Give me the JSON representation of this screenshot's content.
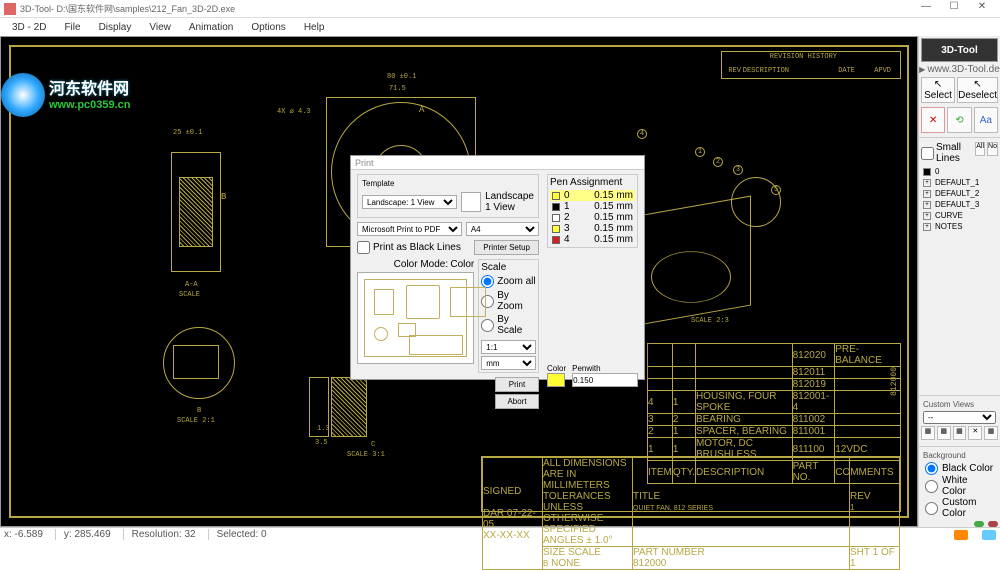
{
  "window": {
    "title": "3D-Tool- D:\\国东软件网\\samples\\212_Fan_3D-2D.exe",
    "min": "—",
    "max": "☐",
    "close": "✕"
  },
  "menu": [
    "3D - 2D",
    "File",
    "Display",
    "View",
    "Animation",
    "Options",
    "Help"
  ],
  "watermark": {
    "site": "河东软件网",
    "url": "www.pc0359.cn"
  },
  "logo": {
    "text": "3D-Tool",
    "url": "www.3D-Tool.de"
  },
  "tools": {
    "select": "Select",
    "deselect": "Deselect",
    "small_lines": "Small Lines",
    "all": "All",
    "no": "No"
  },
  "tree": [
    {
      "label": "0"
    },
    {
      "label": "DEFAULT_1"
    },
    {
      "label": "DEFAULT_2"
    },
    {
      "label": "DEFAULT_3"
    },
    {
      "label": "CURVE"
    },
    {
      "label": "NOTES"
    }
  ],
  "custom": {
    "label": "Custom Views",
    "select": "--"
  },
  "background": {
    "label": "Background",
    "options": [
      "Black Color",
      "White Color",
      "Custom Color"
    ],
    "selected": 0
  },
  "status": {
    "x": "x: -6.589",
    "y": "y: 285.469",
    "res": "Resolution:  32",
    "sel": "Selected:  0"
  },
  "dialog": {
    "title": "Print",
    "template": {
      "label": "Template",
      "value": "Landscape: 1 View",
      "landscape": "Landscape",
      "views": "1 View"
    },
    "printer": {
      "value": "Microsoft Print to PDF",
      "paper": "A4",
      "setup": "Printer Setup"
    },
    "print_black": "Print as Black Lines",
    "colormode": {
      "label": "Color Mode:",
      "value": "Color"
    },
    "scale": {
      "label": "Scale",
      "options": [
        "Zoom all",
        "By Zoom",
        "By Scale"
      ],
      "selected": 0,
      "ratio": "1:1",
      "unit": "mm"
    },
    "pen": {
      "label": "Pen Assignment",
      "rows": [
        {
          "n": "0",
          "w": "0.15 mm",
          "c": "#ffff33"
        },
        {
          "n": "1",
          "w": "0.15 mm",
          "c": "#000000"
        },
        {
          "n": "2",
          "w": "0.15 mm",
          "c": "#ffffff"
        },
        {
          "n": "3",
          "w": "0.15 mm",
          "c": "#ffff33"
        },
        {
          "n": "4",
          "w": "0.15 mm",
          "c": "#cc2222"
        }
      ],
      "color_lbl": "Color",
      "penwidth_lbl": "Penwith",
      "penwidth": "0.150"
    },
    "print_btn": "Print",
    "abort_btn": "Abort"
  },
  "cad": {
    "history": "REVISION HISTORY",
    "hist_cols": [
      "REV",
      "DESCRIPTION",
      "DATE",
      "APVD"
    ],
    "scale_aa": "A-A",
    "scale_aa_v": "SCALE",
    "scale_b": "B",
    "scale_b_v": "SCALE  2:1",
    "scale_c": "C",
    "scale_c_v": "SCALE  3:1",
    "scale_23": "SCALE   2:3",
    "dim_25": "25 ±0.1",
    "dim_80": "80 ±0.1",
    "dim_715": "71.5",
    "dim_4x": "4X ⌀ 4.3",
    "arrow_a": "A",
    "arrow_b": "B",
    "balloons": [
      "1",
      "2",
      "3",
      "4",
      "5"
    ],
    "dim_35": "3.5",
    "dim_13": "1.3",
    "bom": [
      {
        "it": "",
        "qty": "",
        "desc": "",
        "pn": "812020",
        "c": "PRE-BALANCE"
      },
      {
        "it": "",
        "qty": "",
        "desc": "",
        "pn": "812011",
        "c": ""
      },
      {
        "it": "",
        "qty": "",
        "desc": "",
        "pn": "812019",
        "c": ""
      },
      {
        "it": "4",
        "qty": "1",
        "desc": "HOUSING, FOUR SPOKE",
        "pn": "812001-4",
        "c": ""
      },
      {
        "it": "3",
        "qty": "2",
        "desc": "BEARING",
        "pn": "811002",
        "c": ""
      },
      {
        "it": "2",
        "qty": "1",
        "desc": "SPACER, BEARING",
        "pn": "811001",
        "c": ""
      },
      {
        "it": "1",
        "qty": "1",
        "desc": "MOTOR, DC BRUSHLESS",
        "pn": "811100",
        "c": "12VDC"
      }
    ],
    "bom_hdr": [
      "ITEM",
      "QTY.",
      "DESCRIPTION",
      "PART NO.",
      "COMMENTS"
    ],
    "block": {
      "title_lbl": "TITLE",
      "title": "QUIET FAN, 812 SERIES",
      "tol": "ALL DIMENSIONS ARE IN MILLIMETERS",
      "tol2": "TOLERANCES UNLESS OTHERWISE SPECIFIED",
      "tol3": "ANGLES ± 1.0°",
      "size_lbl": "SIZE",
      "size": "B",
      "scale_lbl": "SCALE",
      "scale": "NONE",
      "pn_lbl": "PART NUMBER",
      "pn": "812000",
      "rev_lbl": "REV",
      "rev": "1",
      "sht": "SHT  1   OF   1",
      "dar": "DAR",
      "date": "07-22-05",
      "sigs": "SIGNED",
      "xxxx": "XX-XX-XX"
    },
    "side_pn": "812000"
  }
}
